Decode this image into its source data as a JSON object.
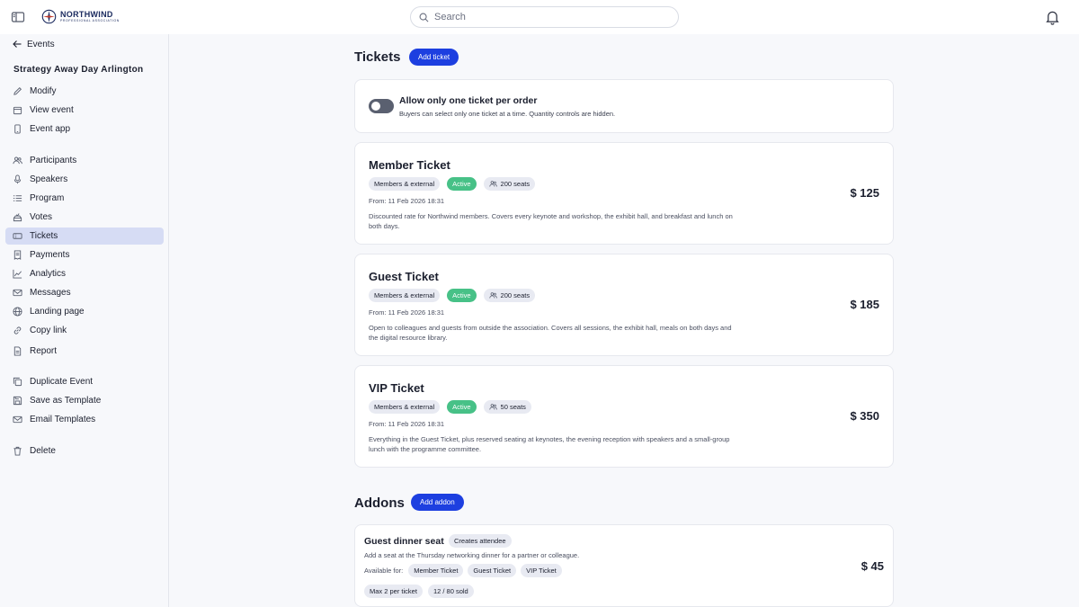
{
  "brand": {
    "name": "NORTHWIND",
    "tagline": "Professional Association",
    "color": "#1a2a5e"
  },
  "search": {
    "placeholder": "Search"
  },
  "sidebar": {
    "back_label": "Events",
    "event_title": "Strategy Away Day Arlington",
    "group1": [
      {
        "label": "Modify",
        "icon": "pencil-icon"
      },
      {
        "label": "View event",
        "icon": "calendar-icon"
      },
      {
        "label": "Event app",
        "icon": "phone-icon"
      }
    ],
    "group2": [
      {
        "label": "Participants",
        "icon": "users-icon"
      },
      {
        "label": "Speakers",
        "icon": "microphone-icon"
      },
      {
        "label": "Program",
        "icon": "list-icon"
      },
      {
        "label": "Votes",
        "icon": "vote-icon"
      },
      {
        "label": "Tickets",
        "icon": "ticket-icon",
        "active": true
      },
      {
        "label": "Payments",
        "icon": "receipt-icon"
      },
      {
        "label": "Analytics",
        "icon": "chart-icon"
      },
      {
        "label": "Messages",
        "icon": "mail-icon"
      },
      {
        "label": "Landing page",
        "icon": "globe-icon"
      },
      {
        "label": "Copy link",
        "icon": "link-icon"
      },
      {
        "label": "Report",
        "icon": "document-icon"
      }
    ],
    "group3": [
      {
        "label": "Duplicate Event",
        "icon": "copy-icon"
      },
      {
        "label": "Save as Template",
        "icon": "save-icon"
      },
      {
        "label": "Email Templates",
        "icon": "mail-icon"
      }
    ],
    "group4": [
      {
        "label": "Delete",
        "icon": "trash-icon"
      }
    ]
  },
  "tickets": {
    "title": "Tickets",
    "add_label": "Add ticket",
    "one_per_order": {
      "title": "Allow only one ticket per order",
      "description": "Buyers can select only one ticket at a time. Quantity controls are hidden.",
      "enabled": false
    },
    "items": [
      {
        "name": "Member Ticket",
        "audience": "Members & external",
        "status": "Active",
        "seats": "200 seats",
        "from": "From: 11 Feb 2026 18:31",
        "description": "Discounted rate for Northwind members. Covers every keynote and workshop, the exhibit hall, and breakfast and lunch on both days.",
        "price": "$ 125"
      },
      {
        "name": "Guest Ticket",
        "audience": "Members & external",
        "status": "Active",
        "seats": "200 seats",
        "from": "From: 11 Feb 2026 18:31",
        "description": "Open to colleagues and guests from outside the association. Covers all sessions, the exhibit hall, meals on both days and the digital resource library.",
        "price": "$ 185"
      },
      {
        "name": "VIP Ticket",
        "audience": "Members & external",
        "status": "Active",
        "seats": "50 seats",
        "from": "From: 11 Feb 2026 18:31",
        "description": "Everything in the Guest Ticket, plus reserved seating at keynotes, the evening reception with speakers and a small-group lunch with the programme committee.",
        "price": "$ 350"
      }
    ]
  },
  "addons": {
    "title": "Addons",
    "add_label": "Add addon",
    "items": [
      {
        "name": "Guest dinner seat",
        "badge": "Creates attendee",
        "description": "Add a seat at the Thursday networking dinner for a partner or colleague.",
        "available_label": "Available for:",
        "available_for": [
          "Member Ticket",
          "Guest Ticket",
          "VIP Ticket"
        ],
        "max": "Max 2 per ticket",
        "sold": "12 / 80 sold",
        "price": "$ 45"
      }
    ]
  },
  "colors": {
    "accent": "#1d3fe0",
    "active_status": "#47c187",
    "nav_active": "#d6dcf4"
  }
}
